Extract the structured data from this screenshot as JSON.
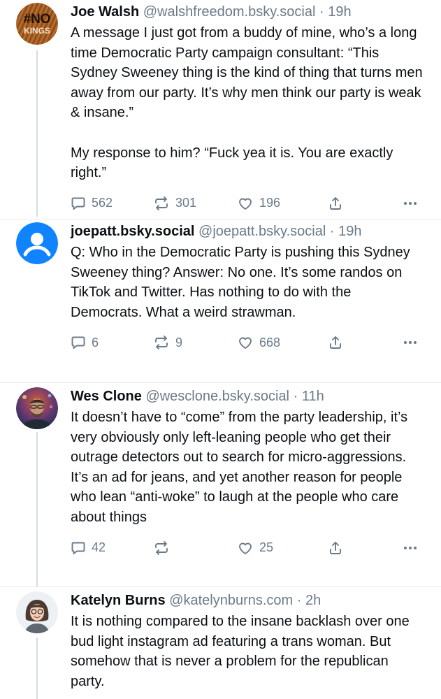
{
  "posts": [
    {
      "name": "Joe Walsh",
      "handle": "@walshfreedom.bsky.social",
      "separator": "·",
      "time": "19h",
      "avatar": "no-kings-avatar",
      "text": "A message I just got from a buddy of mine, who’s a long time Democratic Party campaign consultant: “This Sydney Sweeney thing is the kind of thing that turns men away from our party. It’s why men think our party is weak & insane.”\n\nMy response to him? “Fuck yea it is. You are exactly right.”",
      "replies": "562",
      "reposts": "301",
      "likes": "196"
    },
    {
      "name": "joepatt.bsky.social",
      "handle": "@joepatt.bsky.social",
      "separator": "·",
      "time": "19h",
      "avatar": "default-user-avatar",
      "text": "Q: Who in the Democratic Party is pushing this Sydney Sweeney thing? Answer: No one. It’s some randos on TikTok and Twitter. Has nothing to do with the Democrats. What a weird strawman.",
      "replies": "6",
      "reposts": "9",
      "likes": "668"
    },
    {
      "name": "Wes Clone",
      "handle": "@wesclone.bsky.social",
      "separator": "·",
      "time": "11h",
      "avatar": "photo-avatar",
      "text": "It doesn’t have to “come” from the party leadership, it’s very obviously only left-leaning people who get their outrage detectors out to search for micro-aggressions.  It’s an ad for jeans, and yet another reason for people who lean “anti-woke” to laugh at the people who care about things",
      "replies": "42",
      "reposts": "",
      "likes": "25"
    },
    {
      "name": "Katelyn Burns",
      "handle": "@katelynburns.com",
      "separator": "·",
      "time": "2h",
      "avatar": "illustrated-avatar",
      "text": "It is nothing compared to the insane backlash over one bud light instagram ad featuring a trans woman. But somehow that is never a problem for the republican party."
    }
  ],
  "avatar_badge": {
    "line1": "#NO",
    "line2": "KINGS"
  },
  "colors": {
    "text": "#0b0f14",
    "muted": "#6b7a89",
    "default_avatar_blue": "#1083fe",
    "thread_line": "#d4dbe2"
  }
}
